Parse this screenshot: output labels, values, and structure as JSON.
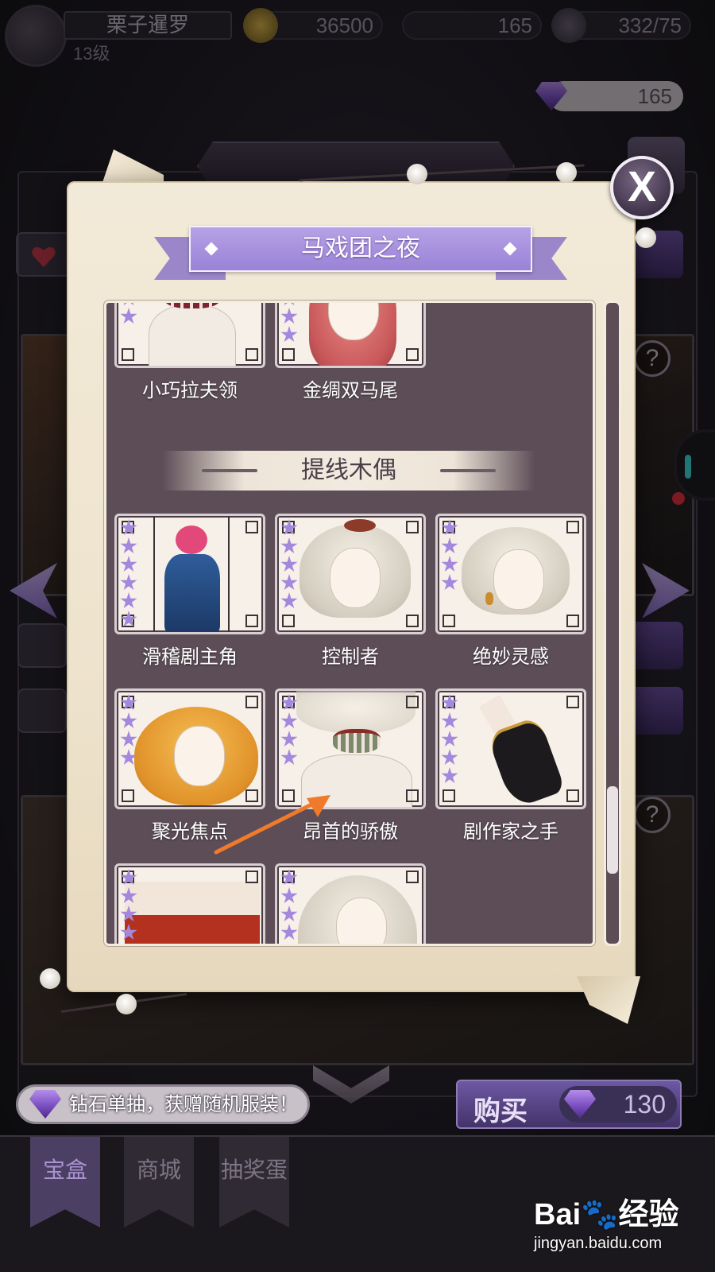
{
  "player": {
    "name": "栗子暹罗",
    "level": "13级"
  },
  "resources": {
    "gold": "36500",
    "gems": "165",
    "stamina": "332/75"
  },
  "gem_counter": "165",
  "modal": {
    "title": "马戏团之夜",
    "close_label": "X",
    "top_items": [
      {
        "label": "小巧拉夫领",
        "stars": 4,
        "icon": "ruff-collar-icon"
      },
      {
        "label": "金绸双马尾",
        "stars": 5,
        "icon": "pink-twin-tails-hair-icon"
      }
    ],
    "section_title": "提线木偶",
    "section_items": [
      {
        "label": "滑稽剧主角",
        "stars": 6,
        "icon": "marionette-costume-icon"
      },
      {
        "label": "控制者",
        "stars": 5,
        "icon": "white-hair-crown-icon"
      },
      {
        "label": "绝妙灵感",
        "stars": 4,
        "icon": "white-bob-hair-icon"
      },
      {
        "label": "聚光焦点",
        "stars": 4,
        "icon": "orange-curly-hair-icon"
      },
      {
        "label": "昂首的骄傲",
        "stars": 4,
        "icon": "neck-ruff-accessory-icon"
      },
      {
        "label": "剧作家之手",
        "stars": 5,
        "icon": "black-glove-icon"
      },
      {
        "label": "",
        "stars": 4,
        "icon": "jester-outfit-icon"
      },
      {
        "label": "",
        "stars": 4,
        "icon": "white-long-hair-icon"
      }
    ],
    "scroll_position": 0.75
  },
  "bottom": {
    "info_text": "钻石单抽，获赠随机服装！",
    "buy_label": "购买",
    "price": "130"
  },
  "nav_tabs": [
    "宝盒",
    "商城",
    "抽奖蛋"
  ],
  "watermark": {
    "brand": "Bai",
    "suffix": "经验",
    "url": "jingyan.baidu.com"
  },
  "colors": {
    "accent_purple": "#9a82d6",
    "parchment": "#f0e6d2",
    "list_bg": "#5c4d56",
    "annotation_arrow": "#f07a2c"
  }
}
